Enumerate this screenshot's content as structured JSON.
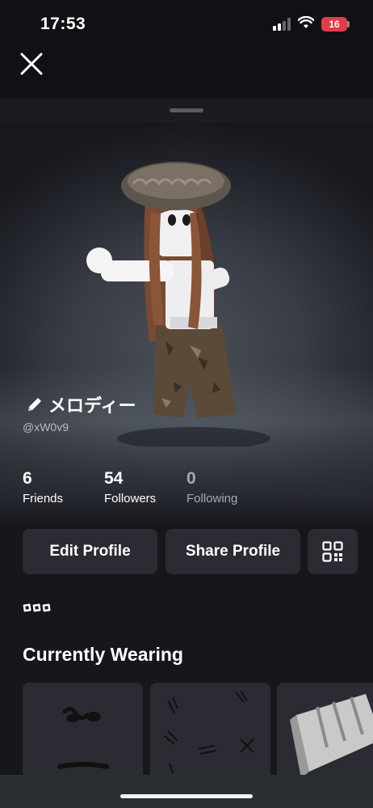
{
  "status_bar": {
    "time": "17:53",
    "battery": "16",
    "battery_color": "#e23b4a",
    "icons": [
      "signal-icon",
      "wifi-icon",
      "battery-icon"
    ]
  },
  "nav": {
    "close_icon": "close-icon"
  },
  "profile": {
    "display_name": "メロディー",
    "username": "@xW0v9",
    "edit_icon": "pencil-icon"
  },
  "stats": [
    {
      "value": "6",
      "label": "Friends"
    },
    {
      "value": "54",
      "label": "Followers"
    },
    {
      "value": "0",
      "label": "Following"
    }
  ],
  "actions": {
    "edit_profile": "Edit Profile",
    "share_profile": "Share Profile",
    "qr_icon": "qr-code-icon"
  },
  "more_icon": "more-dots-icon",
  "currently_wearing": {
    "title": "Currently Wearing",
    "items": [
      "face-item",
      "markings-item",
      "accessory-item"
    ]
  },
  "colors": {
    "background": "#141418",
    "button": "#2a2b33",
    "card": "#2b2c33",
    "muted_text": "#a7a9b0"
  }
}
